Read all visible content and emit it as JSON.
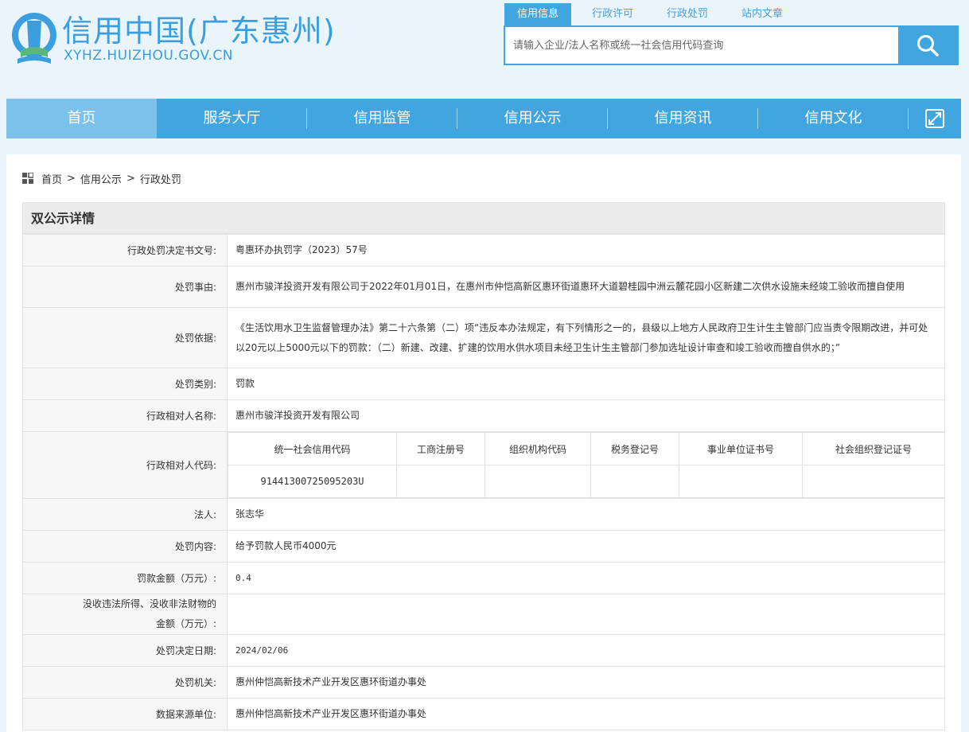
{
  "header": {
    "title": "信用中国(广东惠州)",
    "url": "XYHZ.HUIZHOU.GOV.CN",
    "search_tabs": [
      "信用信息",
      "行政许可",
      "行政处罚",
      "站内文章"
    ],
    "search_placeholder": "请输入企业/法人名称或统一社会信用代码查询"
  },
  "nav": {
    "items": [
      "首页",
      "服务大厅",
      "信用监管",
      "信用公示",
      "信用资讯",
      "信用文化"
    ],
    "active": "首页"
  },
  "breadcrumb": {
    "items": [
      "首页",
      "信用公示",
      "行政处罚"
    ],
    "separator": ">"
  },
  "detail": {
    "title": "双公示详情",
    "rows": {
      "decision_no": {
        "label": "行政处罚决定书文号:",
        "value": "粤惠环办执罚字（2023）57号"
      },
      "reason": {
        "label": "处罚事由:",
        "value": "惠州市骏洋投资开发有限公司于2022年01月01日，在惠州市仲恺高新区惠环街道惠环大道碧桂园中洲云麓花园小区新建二次供水设施未经竣工验收而擅自使用"
      },
      "basis": {
        "label": "处罚依据:",
        "value": "《生活饮用水卫生监督管理办法》第二十六条第（二）项“违反本办法规定，有下列情形之一的，县级以上地方人民政府卫生计生主管部门应当责令限期改进，并可处以20元以上5000元以下的罚款：（二）新建、改建、扩建的饮用水供水项目未经卫生计生主管部门参加选址设计审查和竣工验收而擅自供水的；”"
      },
      "category": {
        "label": "处罚类别:",
        "value": "罚款"
      },
      "party_name": {
        "label": "行政相对人名称:",
        "value": "惠州市骏洋投资开发有限公司"
      },
      "party_code": {
        "label": "行政相对人代码:",
        "columns": [
          "统一社会信用代码",
          "工商注册号",
          "组织机构代码",
          "税务登记号",
          "事业单位证书号",
          "社会组织登记证号"
        ],
        "values": [
          "91441300725095203U",
          "",
          "",
          "",
          "",
          ""
        ]
      },
      "legal_person": {
        "label": "法人:",
        "value": "张志华"
      },
      "content": {
        "label": "处罚内容:",
        "value": "给予罚款人民币4000元"
      },
      "fine": {
        "label": "罚款金额（万元）:",
        "value": "0.4"
      },
      "confiscation": {
        "label_1": "没收违法所得、没收非法财物的",
        "label_2": "金额（万元）:",
        "value": ""
      },
      "date": {
        "label": "处罚决定日期:",
        "value": "2024/02/06"
      },
      "authority": {
        "label": "处罚机关:",
        "value": "惠州仲恺高新技术产业开发区惠环街道办事处"
      },
      "source": {
        "label": "数据来源单位:",
        "value": "惠州仲恺高新技术产业开发区惠环街道办事处"
      }
    }
  },
  "colors": {
    "primary": "#41a6e0",
    "nav_active": "#7cc1ec",
    "page_bg": "#eaf4fb"
  },
  "icons": [
    "logo-emblem",
    "search-icon",
    "expand-icon",
    "grid-icon"
  ]
}
